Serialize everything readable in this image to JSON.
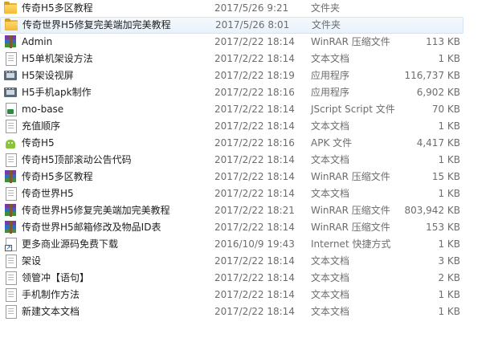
{
  "files": [
    {
      "name": "传奇H5多区教程",
      "date": "2017/5/26 9:21",
      "type": "文件夹",
      "size": "",
      "icon": "folder-icon",
      "selected": false
    },
    {
      "name": "传奇世界H5修复完美端加完美教程",
      "date": "2017/5/26 8:01",
      "type": "文件夹",
      "size": "",
      "icon": "folder-icon",
      "selected": true
    },
    {
      "name": "Admin",
      "date": "2017/2/22 18:14",
      "type": "WinRAR 压缩文件",
      "size": "113 KB",
      "icon": "winrar-archive-icon",
      "selected": false
    },
    {
      "name": "H5单机架设方法",
      "date": "2017/2/22 18:14",
      "type": "文本文档",
      "size": "1 KB",
      "icon": "text-document-icon",
      "selected": false
    },
    {
      "name": "H5架设视屏",
      "date": "2017/2/22 18:19",
      "type": "应用程序",
      "size": "116,737 KB",
      "icon": "application-icon",
      "selected": false
    },
    {
      "name": "H5手机apk制作",
      "date": "2017/2/22 18:16",
      "type": "应用程序",
      "size": "6,902 KB",
      "icon": "application-icon",
      "selected": false
    },
    {
      "name": "mo-base",
      "date": "2017/2/22 18:14",
      "type": "JScript Script 文件",
      "size": "70 KB",
      "icon": "jscript-file-icon",
      "selected": false
    },
    {
      "name": "充值顺序",
      "date": "2017/2/22 18:14",
      "type": "文本文档",
      "size": "1 KB",
      "icon": "text-document-icon",
      "selected": false
    },
    {
      "name": "传奇H5",
      "date": "2017/2/22 18:16",
      "type": "APK 文件",
      "size": "4,417 KB",
      "icon": "android-apk-icon",
      "selected": false
    },
    {
      "name": "传奇H5顶部滚动公告代码",
      "date": "2017/2/22 18:14",
      "type": "文本文档",
      "size": "1 KB",
      "icon": "text-document-icon",
      "selected": false
    },
    {
      "name": "传奇H5多区教程",
      "date": "2017/2/22 18:14",
      "type": "WinRAR 压缩文件",
      "size": "15 KB",
      "icon": "winrar-archive-icon",
      "selected": false
    },
    {
      "name": "传奇世界H5",
      "date": "2017/2/22 18:14",
      "type": "文本文档",
      "size": "1 KB",
      "icon": "text-document-icon",
      "selected": false
    },
    {
      "name": "传奇世界H5修复完美端加完美教程",
      "date": "2017/2/22 18:21",
      "type": "WinRAR 压缩文件",
      "size": "803,942 KB",
      "icon": "winrar-archive-icon",
      "selected": false
    },
    {
      "name": "传奇世界H5邮箱修改及物品ID表",
      "date": "2017/2/22 18:14",
      "type": "WinRAR 压缩文件",
      "size": "153 KB",
      "icon": "winrar-archive-icon",
      "selected": false
    },
    {
      "name": "更多商业源码免费下载",
      "date": "2016/10/9 19:43",
      "type": "Internet 快捷方式",
      "size": "1 KB",
      "icon": "internet-shortcut-icon",
      "selected": false
    },
    {
      "name": "架设",
      "date": "2017/2/22 18:14",
      "type": "文本文档",
      "size": "3 KB",
      "icon": "text-document-icon",
      "selected": false
    },
    {
      "name": "领管冲【语句】",
      "date": "2017/2/22 18:14",
      "type": "文本文档",
      "size": "2 KB",
      "icon": "text-document-icon",
      "selected": false
    },
    {
      "name": "手机制作方法",
      "date": "2017/2/22 18:14",
      "type": "文本文档",
      "size": "1 KB",
      "icon": "text-document-icon",
      "selected": false
    },
    {
      "name": "新建文本文档",
      "date": "2017/2/22 18:14",
      "type": "文本文档",
      "size": "1 KB",
      "icon": "text-document-icon",
      "selected": false
    }
  ]
}
